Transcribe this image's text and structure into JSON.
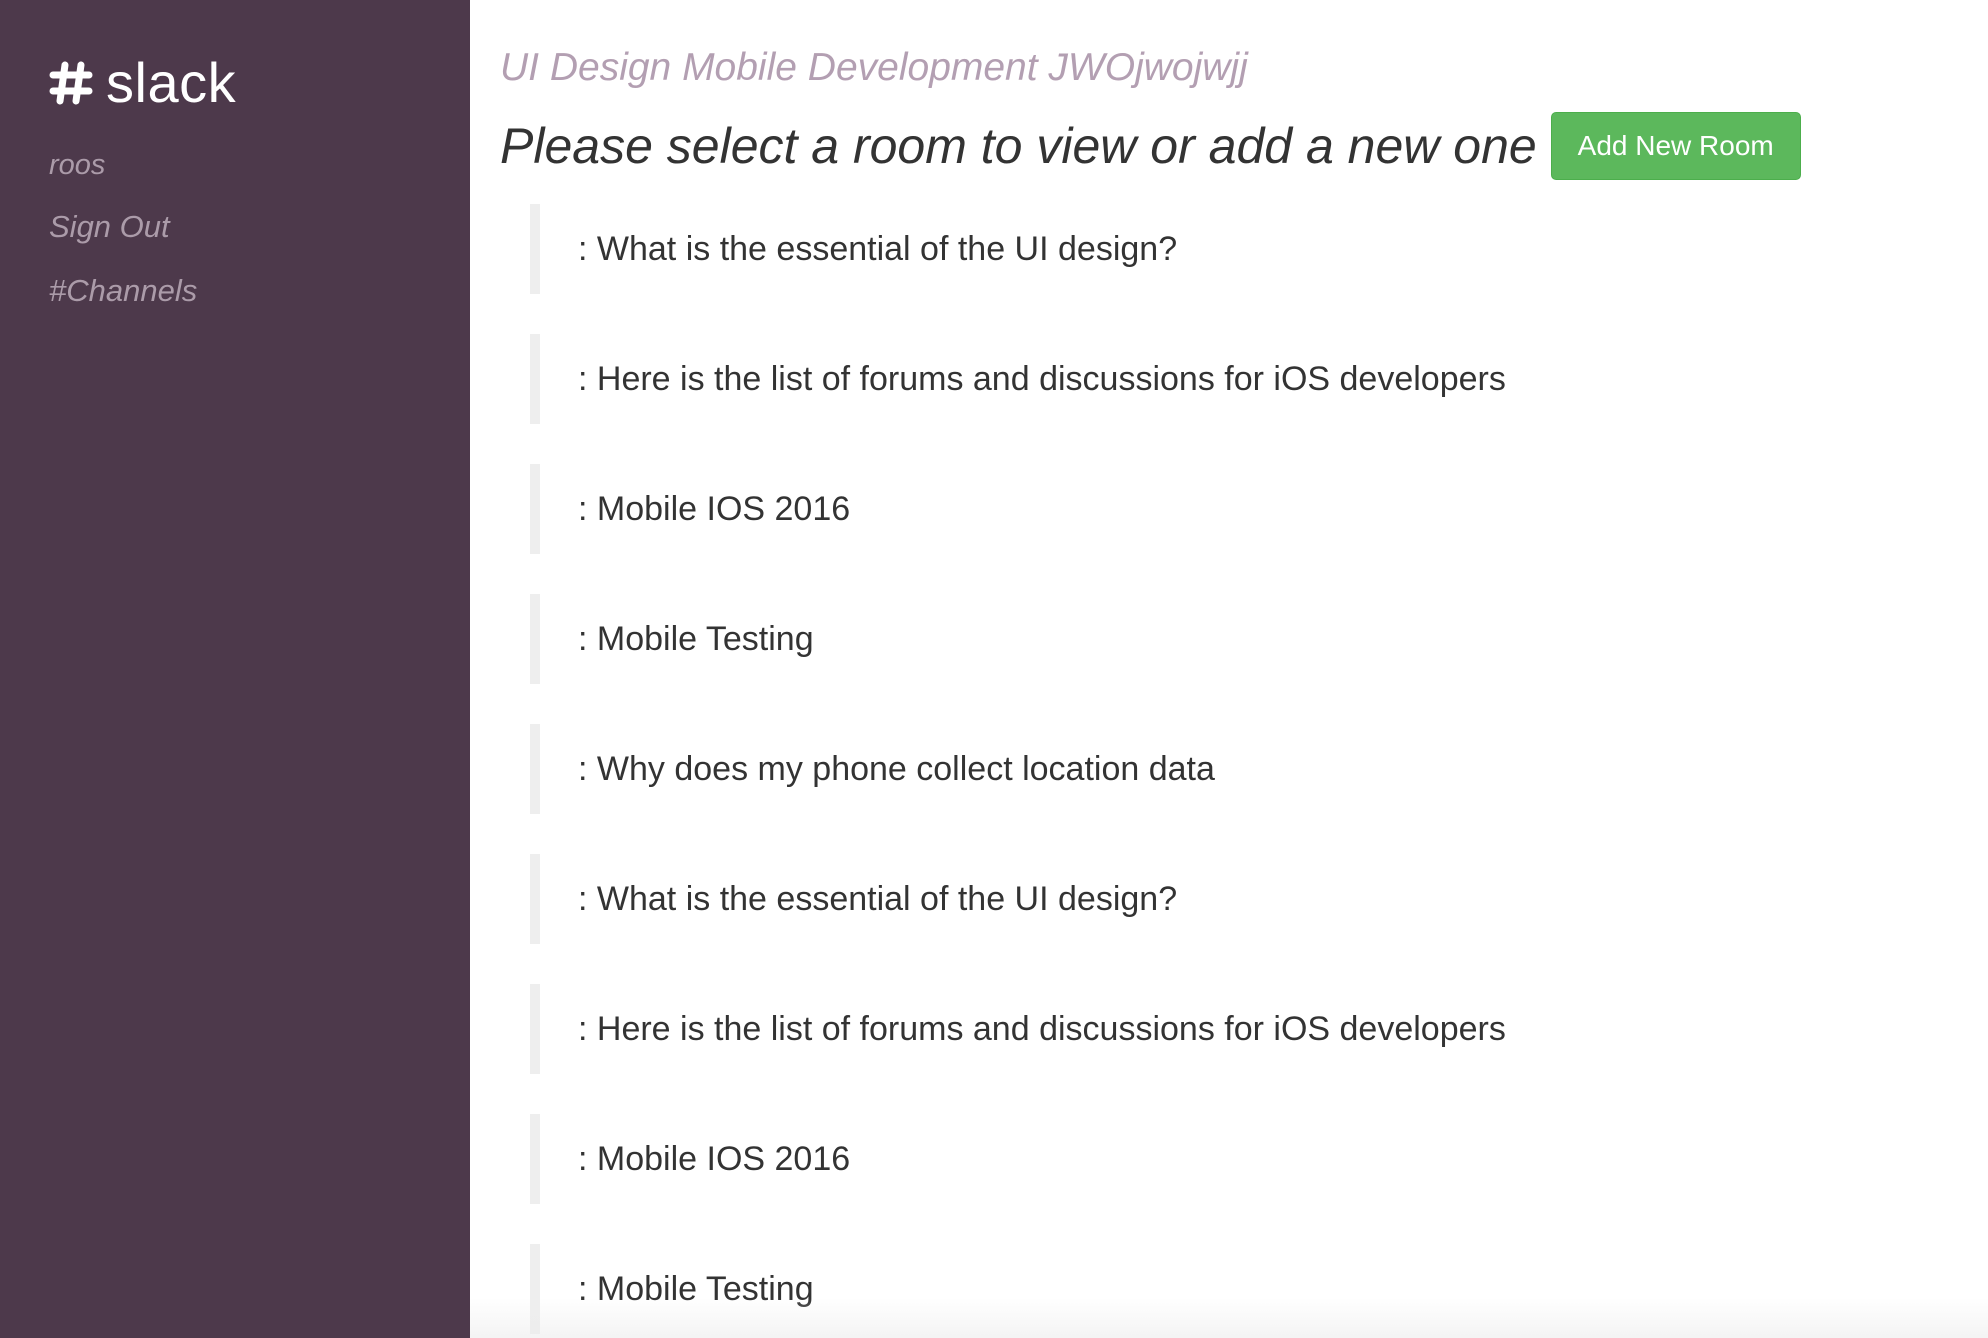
{
  "sidebar": {
    "brand": {
      "icon": "slack-hash-icon",
      "name": "slack"
    },
    "user": "roos",
    "sign_out": "Sign Out",
    "channels": "#Channels"
  },
  "main": {
    "subtitle": "UI Design Mobile Development JWOjwojwjj",
    "heading": "Please select a room to view or add a new one",
    "add_room_label": "Add New Room",
    "rooms": [
      ": What is the essential of the UI design?",
      ": Here is the list of forums and discussions for iOS developers",
      ": Mobile IOS 2016",
      ": Mobile Testing",
      ": Why does my phone collect location data",
      ": What is the essential of the UI design?",
      ": Here is the list of forums and discussions for iOS developers",
      ": Mobile IOS 2016",
      ": Mobile Testing"
    ]
  },
  "colors": {
    "sidebar_bg": "#4d394b",
    "sidebar_link": "#ab9ba9",
    "subtitle": "#b39fb2",
    "button_green": "#5cb85c",
    "room_border": "#eeeeee",
    "text": "#333333"
  }
}
